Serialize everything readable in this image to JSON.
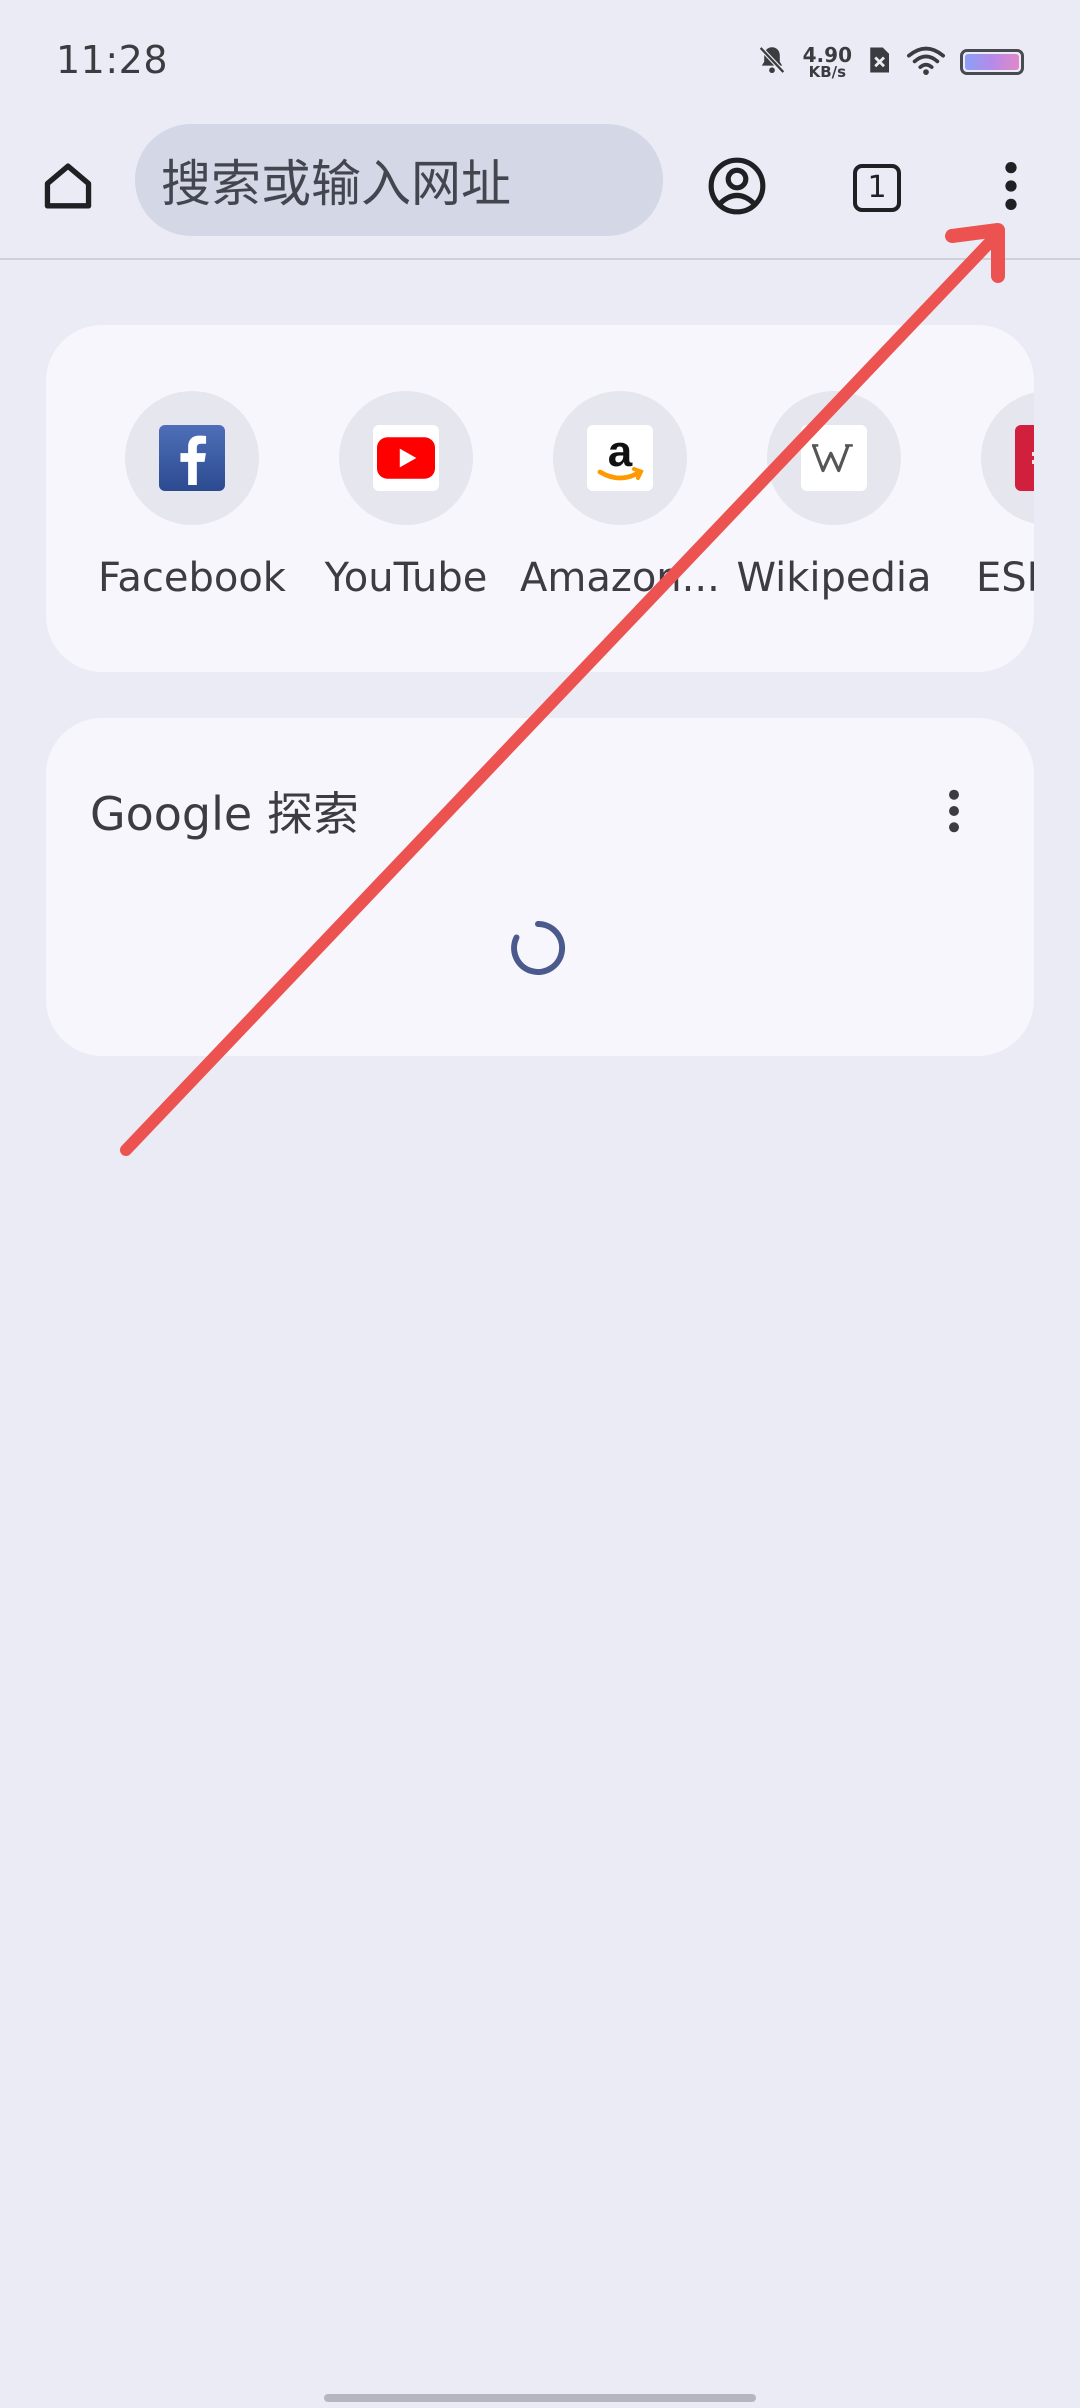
{
  "status_bar": {
    "time": "11:28",
    "net_speed_value": "4.90",
    "net_speed_unit": "KB/s",
    "battery_level": 1.0
  },
  "toolbar": {
    "omnibox_placeholder": "搜索或输入网址",
    "tab_count": "1"
  },
  "shortcuts": [
    {
      "label": "Facebook",
      "icon": "facebook-icon",
      "color": "#3b5998"
    },
    {
      "label": "YouTube",
      "icon": "youtube-icon",
      "color": "#ff0000"
    },
    {
      "label": "Amazon....",
      "icon": "amazon-icon",
      "color": "#ff9900"
    },
    {
      "label": "Wikipedia",
      "icon": "wikipedia-icon",
      "color": "#555555"
    },
    {
      "label": "ESPN",
      "icon": "espn-icon",
      "color": "#d1203d"
    }
  ],
  "google_card": {
    "title": "Google 探索"
  },
  "annotation": {
    "color": "#ec5350",
    "kind": "arrow"
  }
}
